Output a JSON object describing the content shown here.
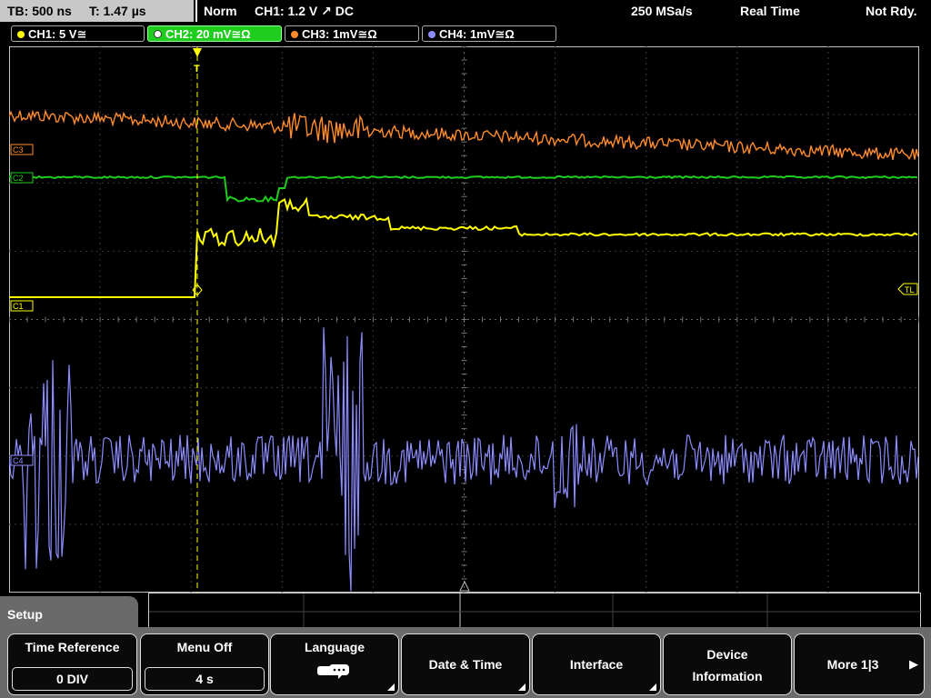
{
  "status": {
    "tb": "TB: 500 ns",
    "trig_time": "T: 1.47 µs",
    "mode": "Norm",
    "trigger": "CH1: 1.2 V ↗ DC",
    "sample_rate": "250 MSa/s",
    "acq_mode": "Real Time",
    "state": "Not Rdy."
  },
  "channels": [
    {
      "label": "CH1: 5 V≅",
      "color": "#ffff00"
    },
    {
      "label": "CH2: 20 mV≅Ω",
      "color": "#1fcd1f"
    },
    {
      "label": "CH3: 1mV≅Ω",
      "color": "#ff8c2a"
    },
    {
      "label": "CH4: 1mV≅Ω",
      "color": "#8c8cff"
    }
  ],
  "markers": {
    "c1": "C1",
    "c2": "C2",
    "c3": "C3",
    "c4": "C4",
    "trigger_level": "TL",
    "trigger_pos": "T"
  },
  "menu": {
    "title": "Setup",
    "time_reference": {
      "label": "Time Reference",
      "value": "0 DIV"
    },
    "menu_off": {
      "label": "Menu Off",
      "value": "4 s"
    },
    "language": {
      "label": "Language"
    },
    "date_time": {
      "label": "Date & Time"
    },
    "interface": {
      "label": "Interface"
    },
    "device_info": {
      "line1": "Device",
      "line2": "Information"
    },
    "more": {
      "label": "More 1|3"
    }
  },
  "trace_colors": {
    "ch1": "#ffff00",
    "ch2": "#1fcd1f",
    "ch3": "#ff8c2a",
    "ch4": "#8c8cff"
  }
}
